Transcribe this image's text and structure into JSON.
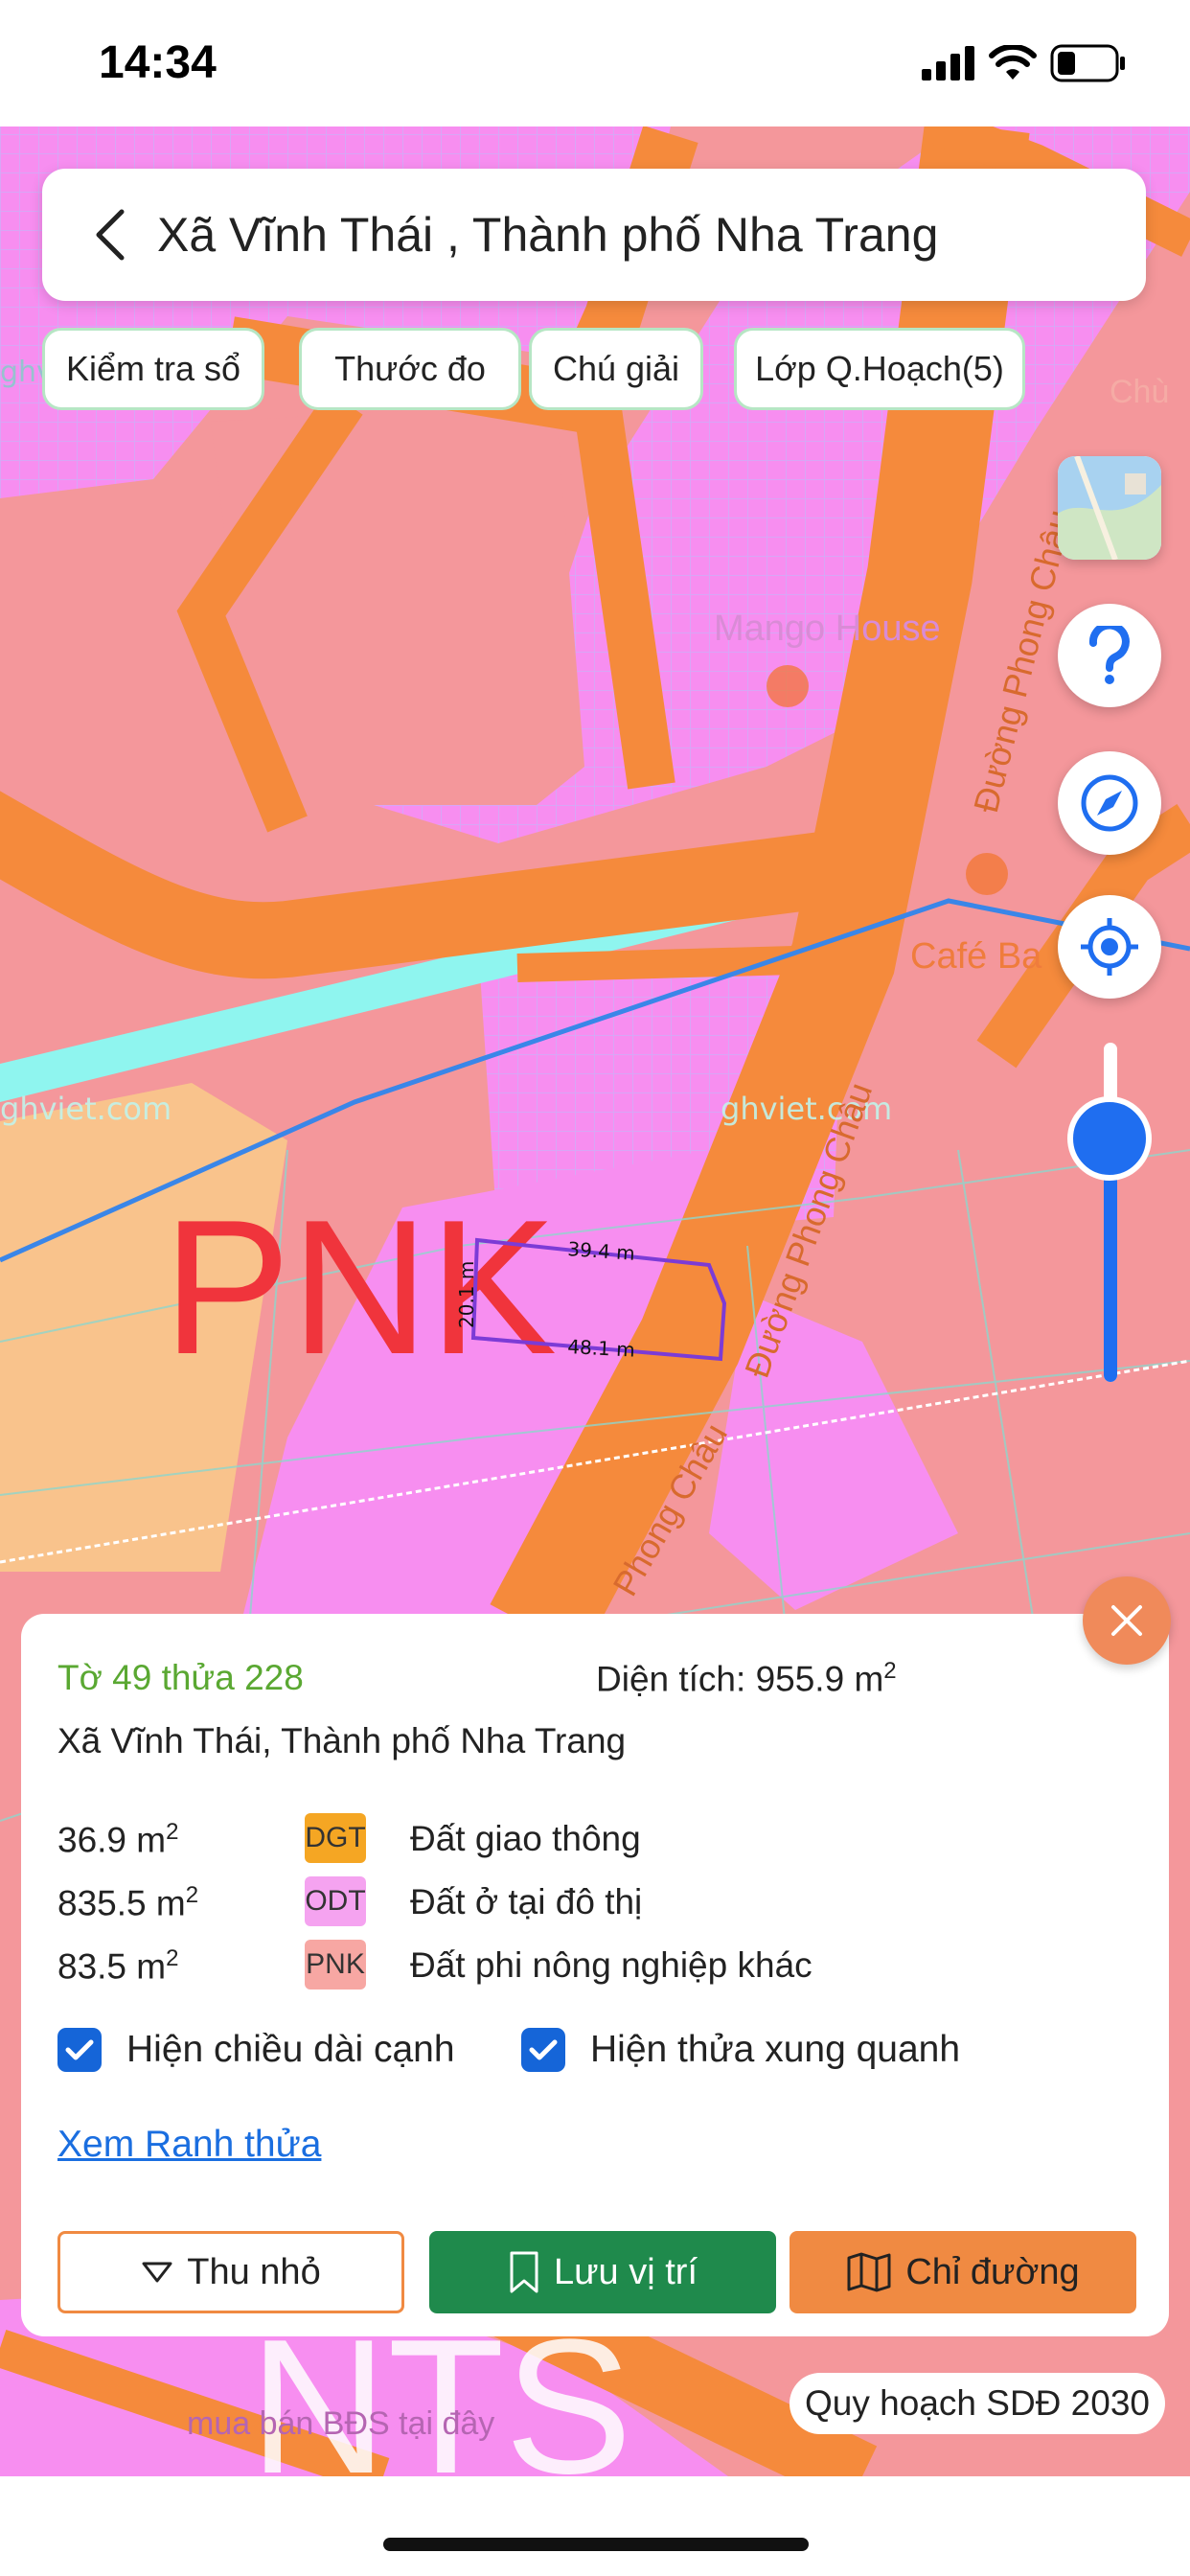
{
  "status": {
    "time": "14:34"
  },
  "header": {
    "title": "Xã Vĩnh Thái , Thành phố Nha Trang"
  },
  "chips": [
    "Kiểm tra sổ",
    "Thước đo",
    "Chú giải",
    "Lớp Q.Hoạch(5)"
  ],
  "map": {
    "zone_label": "PNK",
    "bottom_label": "NTS",
    "watermarks": [
      "ghviet.com",
      "ghviet.com",
      "ghviet.com"
    ],
    "pois": [
      "Mango House",
      "Café Ba"
    ],
    "road_names": [
      "Đường Phong Châu",
      "Đường Phong Châu",
      "Phong Châu"
    ],
    "ad_text": "mua bán BĐS tại đây",
    "faded_labels": [
      "Chù"
    ],
    "edges": {
      "top": "39.4 m",
      "left": "20.1 m",
      "bottom": "48.1 m"
    },
    "zoom_level": 0.65
  },
  "panel": {
    "parcel_id": "Tờ 49 thửa 228",
    "area_label": "Diện tích: 955.9 m",
    "area_sup": "2",
    "location": "Xã Vĩnh Thái, Thành phố Nha Trang",
    "rows": [
      {
        "area": "36.9 m",
        "sup": "2",
        "code": "DGT",
        "desc": "Đất giao thông",
        "color": "#f5a623"
      },
      {
        "area": "835.5 m",
        "sup": "2",
        "code": "ODT",
        "desc": "Đất ở tại đô thị",
        "color": "#f5a3f0"
      },
      {
        "area": "83.5 m",
        "sup": "2",
        "code": "PNK",
        "desc": "Đất phi nông nghiệp khác",
        "color": "#f7a7a3"
      }
    ],
    "checkboxes": [
      {
        "label": "Hiện chiều dài cạnh",
        "checked": true
      },
      {
        "label": "Hiện thửa xung quanh",
        "checked": true
      }
    ],
    "link": "Xem Ranh thửa",
    "buttons": {
      "collapse": "Thu nhỏ",
      "save": "Lưu vị trí",
      "directions": "Chỉ đường"
    }
  },
  "plan_label": "Quy hoạch SDĐ 2030",
  "colors": {
    "road": "#f58a3c",
    "residential": "#f78ef0",
    "other": "#f4979b",
    "water": "#8ff5ef",
    "primary": "#1f6ef0",
    "green": "#1f8a4c",
    "orange": "#f08a42"
  }
}
